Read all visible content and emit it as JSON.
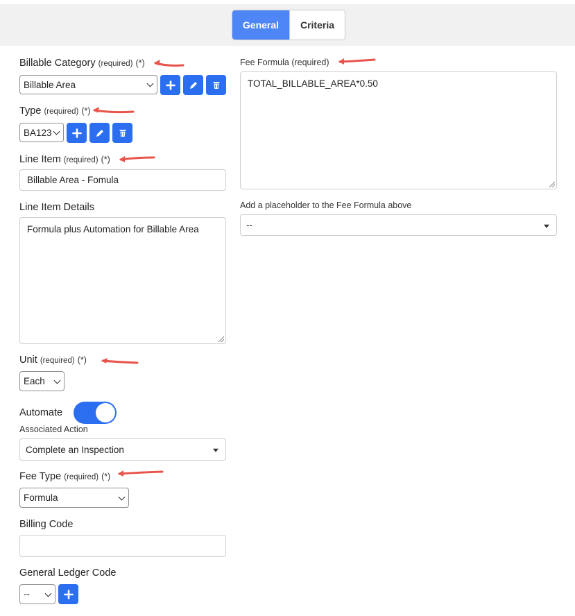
{
  "tabs": [
    {
      "label": "General",
      "active": true
    },
    {
      "label": "Criteria",
      "active": false
    }
  ],
  "form": {
    "billable_category": {
      "label": "Billable Category",
      "required": "(required)",
      "star": "(*)",
      "value": "Billable Area"
    },
    "type": {
      "label": "Type",
      "required": "(required)",
      "star": "(*)",
      "value": "BA123"
    },
    "line_item": {
      "label": "Line Item",
      "required": "(required)",
      "star": "(*)",
      "value": "Billable Area - Fomula"
    },
    "line_item_details": {
      "label": "Line Item Details",
      "value": "Formula plus Automation for Billable Area"
    },
    "unit": {
      "label": "Unit",
      "required": "(required)",
      "star": "(*)",
      "value": "Each"
    },
    "automate": {
      "label": "Automate",
      "on": true
    },
    "associated_action": {
      "label": "Associated Action",
      "value": "Complete an Inspection"
    },
    "fee_type": {
      "label": "Fee Type",
      "required": "(required)",
      "star": "(*)",
      "value": "Formula"
    },
    "billing_code": {
      "label": "Billing Code",
      "value": ""
    },
    "general_ledger_code": {
      "label": "General Ledger Code",
      "value": "--"
    },
    "fee_formula": {
      "label": "Fee Formula (required)",
      "value": "TOTAL_BILLABLE_AREA*0.50"
    },
    "placeholder": {
      "label": "Add a placeholder to the Fee Formula above",
      "value": "--"
    }
  },
  "icons": {
    "add": "plus-icon",
    "edit": "pencil-icon",
    "delete": "trash-icon",
    "annotation": "red-arrow-icon"
  },
  "colors": {
    "primary": "#2b6ff0",
    "tab_active": "#4f86f7",
    "arrow": "#e8534a"
  }
}
